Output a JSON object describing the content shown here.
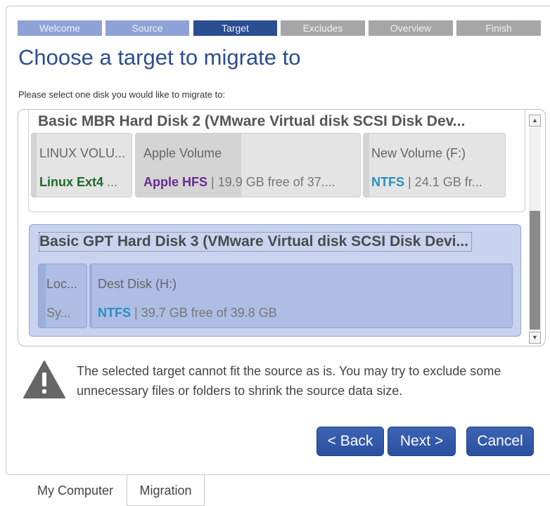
{
  "wizard": {
    "steps": [
      {
        "label": "Welcome",
        "state": "done"
      },
      {
        "label": "Source",
        "state": "done"
      },
      {
        "label": "Target",
        "state": "active"
      },
      {
        "label": "Excludes",
        "state": "pending"
      },
      {
        "label": "Overview",
        "state": "pending"
      },
      {
        "label": "Finish",
        "state": "pending"
      }
    ],
    "title": "Choose a target to migrate to",
    "prompt": "Please select one disk you would like to migrate to:"
  },
  "colors": {
    "step_done": "#8fa2d6",
    "step_active": "#2b4d91",
    "step_pending": "#a6a6a6",
    "fs_ext": "#1e6b2a",
    "fs_hfs": "#6a2b8e",
    "fs_ntfs": "#2a8fbf",
    "button": "#2b4f9f"
  },
  "disks": [
    {
      "header": "Basic MBR Hard Disk 2 (VMware Virtual disk SCSI Disk Dev...",
      "selected": false,
      "volumes": [
        {
          "name": "LINUX VOLU...",
          "fs": "Linux Ext4",
          "info": " ...",
          "used_fraction": 0.05
        },
        {
          "name": "Apple Volume",
          "fs": "Apple HFS",
          "info": " | 19.9 GB free of 37....",
          "used_fraction": 0.47
        },
        {
          "name": "New Volume (F:)",
          "fs": "NTFS",
          "info": " | 24.1 GB fr...",
          "used_fraction": 0.04
        }
      ]
    },
    {
      "header": "Basic GPT Hard Disk 3 (VMware Virtual disk SCSI Disk Devi...",
      "selected": true,
      "volumes": [
        {
          "name": "Loc...",
          "fs": "",
          "info": "Sy...",
          "used_fraction": 0.15
        },
        {
          "name": "Dest Disk (H:)",
          "fs": "NTFS",
          "info": " | 39.7 GB free of 39.8 GB",
          "used_fraction": 0.005
        }
      ]
    }
  ],
  "warning": {
    "icon": "warning-triangle-icon",
    "text": "The selected target cannot fit the source as is. You may try to exclude some unnecessary files or folders to shrink the source data size."
  },
  "buttons": {
    "back": "< Back",
    "next": "Next >",
    "cancel": "Cancel"
  },
  "tabs": [
    {
      "label": "My Computer",
      "active": false
    },
    {
      "label": "Migration",
      "active": true
    }
  ]
}
